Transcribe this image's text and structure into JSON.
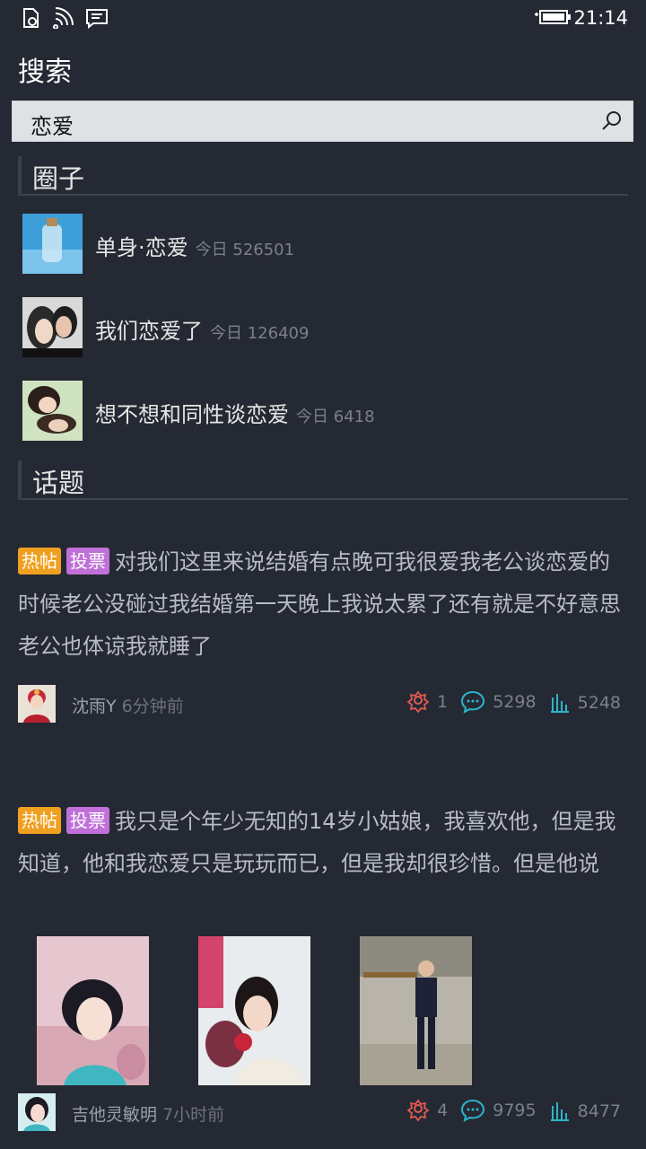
{
  "status": {
    "time": "21:14"
  },
  "header": {
    "title": "搜索"
  },
  "search": {
    "value": "恋爱"
  },
  "sections": {
    "circles": "圈子",
    "topics": "话题"
  },
  "circles": [
    {
      "name": "单身·恋爱",
      "stat": "今日 526501"
    },
    {
      "name": "我们恋爱了",
      "stat": "今日 126409"
    },
    {
      "name": "想不想和同性谈恋爱",
      "stat": "今日 6418"
    }
  ],
  "posts": [
    {
      "tags": [
        "热帖",
        "投票"
      ],
      "text": "对我们这里来说结婚有点晚可我很爱我老公谈恋爱的时候老公没碰过我结婚第一天晚上我说太累了还有就是不好意思老公也体谅我就睡了",
      "author": "沈雨Y",
      "ago": "6分钟前",
      "likes": "1",
      "comments": "5298",
      "views": "5248"
    },
    {
      "tags": [
        "热帖",
        "投票"
      ],
      "text": "我只是个年少无知的14岁小姑娘，我喜欢他，但是我知道，他和我恋爱只是玩玩而已，但是我却很珍惜。但是他说",
      "author": "吉他灵敏明",
      "ago": "7小时前",
      "likes": "4",
      "comments": "9795",
      "views": "8477"
    }
  ],
  "colors": {
    "background": "#252933",
    "hot_tag": "#f0a020",
    "vote_tag": "#c070d8",
    "like_icon": "#e05a50",
    "comment_icon": "#2bb5c8"
  }
}
